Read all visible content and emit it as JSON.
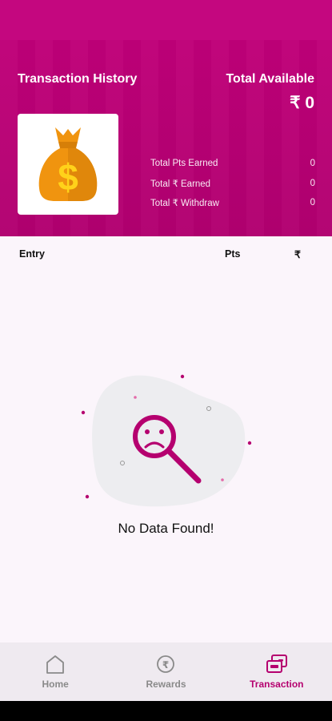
{
  "header": {
    "title": "Transaction History",
    "total_available_label": "Total Available",
    "total_available_value": "₹ 0",
    "stats": [
      {
        "label": "Total Pts Earned",
        "value": "0"
      },
      {
        "label": "Total ₹ Earned",
        "value": "0"
      },
      {
        "label": "Total ₹ Withdraw",
        "value": "0"
      }
    ]
  },
  "table": {
    "columns": [
      "Entry",
      "Pts",
      "₹"
    ]
  },
  "empty_state": {
    "message": "No Data Found!"
  },
  "bottom_nav": {
    "items": [
      {
        "label": "Home",
        "icon": "home-icon",
        "active": false
      },
      {
        "label": "Rewards",
        "icon": "rupee-coin-icon",
        "active": false
      },
      {
        "label": "Transaction",
        "icon": "transaction-icon",
        "active": true
      }
    ]
  },
  "colors": {
    "brand": "#b5006f",
    "bag": "#f0940f",
    "dollar": "#ffd21a"
  }
}
